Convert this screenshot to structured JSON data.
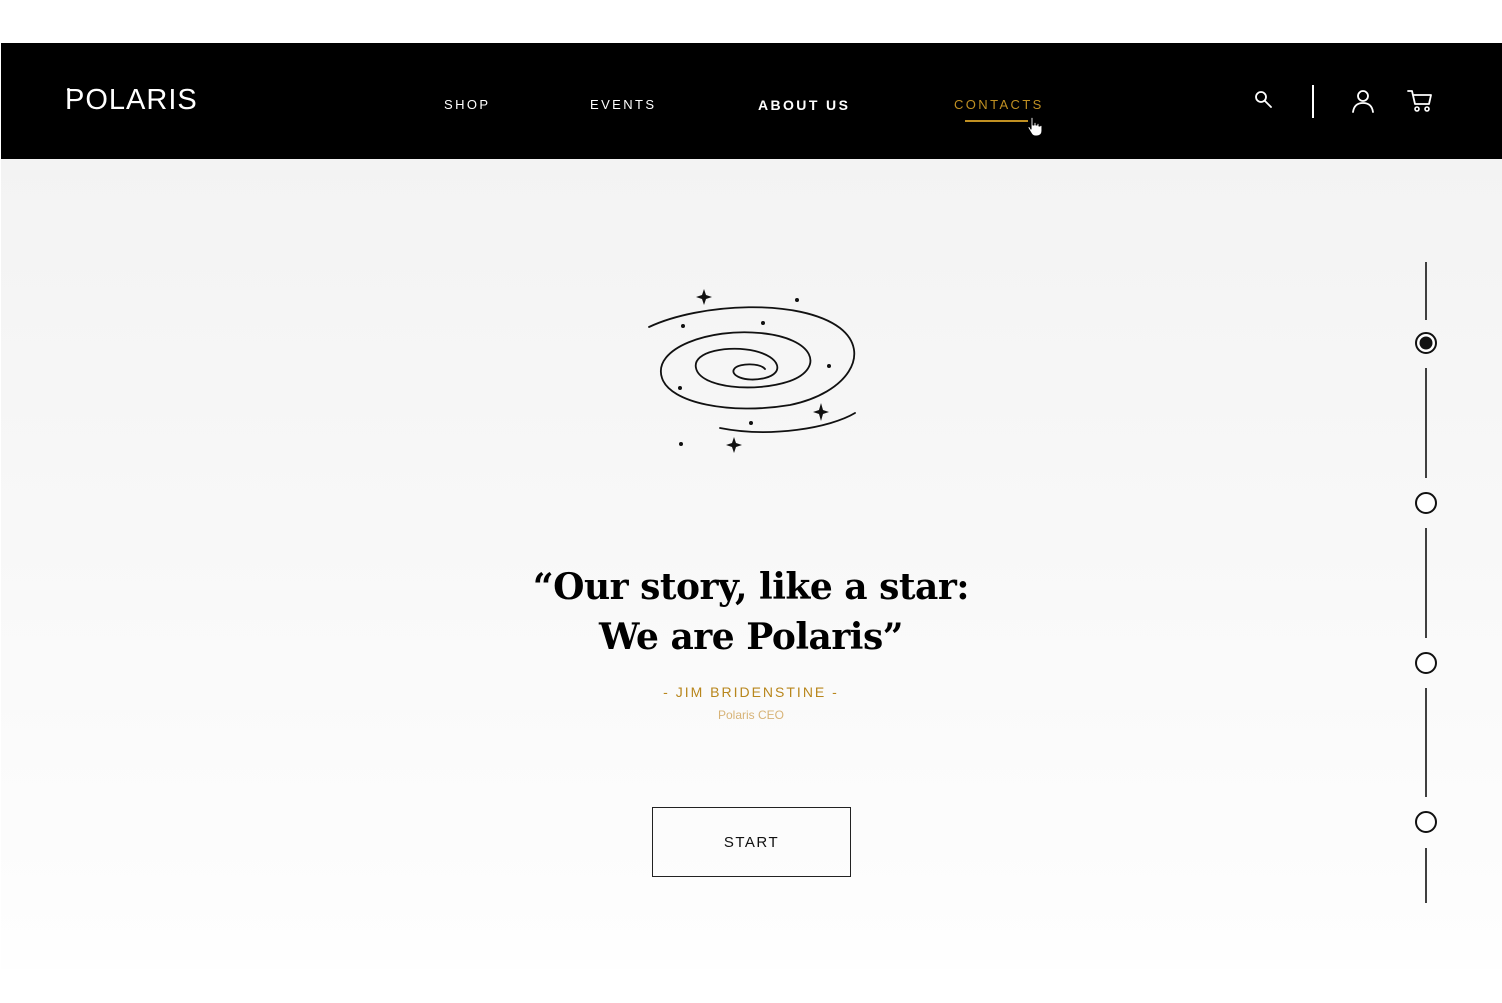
{
  "brand": {
    "logo_text": "POLARIS"
  },
  "nav": {
    "items": [
      {
        "label": "SHOP"
      },
      {
        "label": "EVENTS"
      },
      {
        "label": "ABOUT US"
      },
      {
        "label": "CONTACTS"
      }
    ],
    "active_item": "CONTACTS",
    "bold_item": "ABOUT US"
  },
  "header_icons": [
    "search-icon",
    "user-icon",
    "cart-icon"
  ],
  "hero": {
    "quote_line1": "“Our story, like a star:",
    "quote_line2": "We are Polaris”",
    "author": "-  JIM BRIDENSTINE  -",
    "role": "Polaris CEO",
    "cta_label": "START"
  },
  "pager": {
    "dots": 4,
    "active_index": 0
  },
  "colors": {
    "nav_bg": "#000000",
    "accent_gold": "#c09022",
    "author_gold": "#b8861c",
    "role_gold": "#d7b377",
    "text": "#000000"
  }
}
